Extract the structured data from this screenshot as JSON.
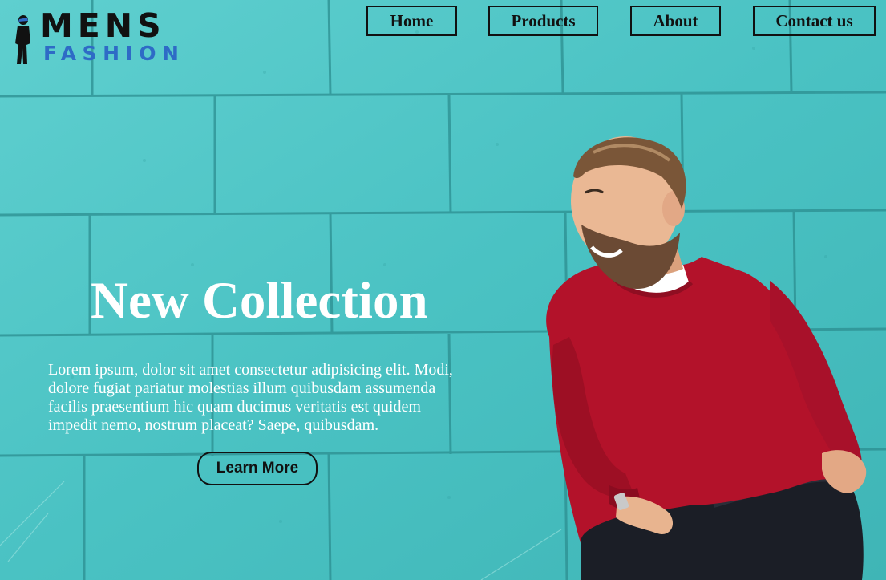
{
  "brand": {
    "line1": "MENS",
    "line2": "FASHION",
    "icon": "man-silhouette-icon",
    "color_primary": "#111111",
    "color_secondary": "#2e6bc6"
  },
  "nav": {
    "items": [
      {
        "label": "Home"
      },
      {
        "label": "Products"
      },
      {
        "label": "About"
      },
      {
        "label": "Contact us"
      }
    ]
  },
  "hero": {
    "title": "New Collection",
    "description": "Lorem ipsum, dolor sit amet consectetur adipisicing elit. Modi, dolore fugiat pariatur molestias illum quibusdam assumenda facilis praesentium hic quam ducimus veritatis est quidem impedit nemo, nostrum placeat? Saepe, quibusdam.",
    "cta_label": "Learn More"
  },
  "colors": {
    "background": "#4fc4c4",
    "sweater": "#b3122a",
    "text_light": "#ffffff"
  },
  "image": {
    "subject": "smiling man in red sweater sitting against turquoise brick wall"
  }
}
